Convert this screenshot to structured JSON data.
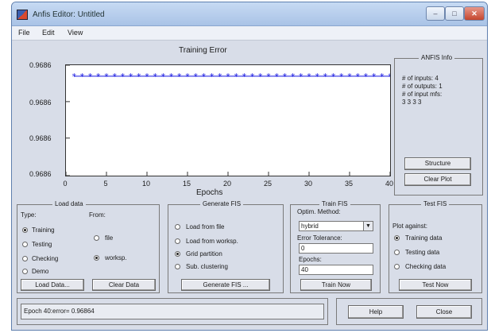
{
  "window": {
    "title": "Anfis Editor: Untitled"
  },
  "menu": [
    "File",
    "Edit",
    "View"
  ],
  "chart_data": {
    "type": "line",
    "title": "Training Error",
    "xlabel": "Epochs",
    "ylabel": "",
    "xlim": [
      0,
      40
    ],
    "ylim": [
      0.96855,
      0.96865
    ],
    "x_ticks": [
      "0",
      "5",
      "10",
      "15",
      "20",
      "25",
      "30",
      "35",
      "40"
    ],
    "y_ticks": [
      "0.9686",
      "0.9686",
      "0.9686",
      "0.9686"
    ],
    "series": [
      {
        "x": [
          1,
          2,
          3,
          4,
          5,
          6,
          7,
          8,
          9,
          10,
          11,
          12,
          13,
          14,
          15,
          16,
          17,
          18,
          19,
          20,
          21,
          22,
          23,
          24,
          25,
          26,
          27,
          28,
          29,
          30,
          31,
          32,
          33,
          34,
          35,
          36,
          37,
          38,
          39,
          40
        ],
        "y": [
          0.96864,
          0.96864,
          0.96864,
          0.96864,
          0.96864,
          0.96864,
          0.96864,
          0.96864,
          0.96864,
          0.96864,
          0.96864,
          0.96864,
          0.96864,
          0.96864,
          0.96864,
          0.96864,
          0.96864,
          0.96864,
          0.96864,
          0.96864,
          0.96864,
          0.96864,
          0.96864,
          0.96864,
          0.96864,
          0.96864,
          0.96864,
          0.96864,
          0.96864,
          0.96864,
          0.96864,
          0.96864,
          0.96864,
          0.96864,
          0.96864,
          0.96864,
          0.96864,
          0.96864,
          0.96864,
          0.96864
        ],
        "color": "#1a1ae0",
        "marker": "*"
      }
    ]
  },
  "anfis_info": {
    "title": "ANFIS Info",
    "lines": [
      "# of inputs: 4",
      "# of outputs: 1",
      "# of input mfs:",
      "3 3 3 3"
    ],
    "structure_button": "Structure",
    "clear_plot_button": "Clear Plot"
  },
  "load_data": {
    "title": "Load data",
    "type_label": "Type:",
    "from_label": "From:",
    "types": [
      {
        "label": "Training",
        "selected": true
      },
      {
        "label": "Testing",
        "selected": false
      },
      {
        "label": "Checking",
        "selected": false
      },
      {
        "label": "Demo",
        "selected": false
      }
    ],
    "from": [
      {
        "label": "file",
        "selected": false
      },
      {
        "label": "worksp.",
        "selected": true
      }
    ],
    "load_button": "Load Data...",
    "clear_button": "Clear Data"
  },
  "generate_fis": {
    "title": "Generate FIS",
    "options": [
      {
        "label": "Load from file",
        "selected": false
      },
      {
        "label": "Load from worksp.",
        "selected": false
      },
      {
        "label": "Grid partition",
        "selected": true
      },
      {
        "label": "Sub. clustering",
        "selected": false
      }
    ],
    "button": "Generate FIS ..."
  },
  "train_fis": {
    "title": "Train FIS",
    "method_label": "Optim. Method:",
    "method_value": "hybrid",
    "tolerance_label": "Error Tolerance:",
    "tolerance_value": "0",
    "epochs_label": "Epochs:",
    "epochs_value": "40",
    "button": "Train Now"
  },
  "test_fis": {
    "title": "Test FIS",
    "plot_label": "Plot against:",
    "options": [
      {
        "label": "Training data",
        "selected": true
      },
      {
        "label": "Testing data",
        "selected": false
      },
      {
        "label": "Checking data",
        "selected": false
      }
    ],
    "button": "Test Now"
  },
  "status": {
    "text": "Epoch 40:error= 0.96864"
  },
  "footer": {
    "help": "Help",
    "close": "Close"
  },
  "colors": {
    "marker": "#1a1ae0",
    "window_bg": "#d8dde8",
    "titlebar": "#b5cdee"
  }
}
